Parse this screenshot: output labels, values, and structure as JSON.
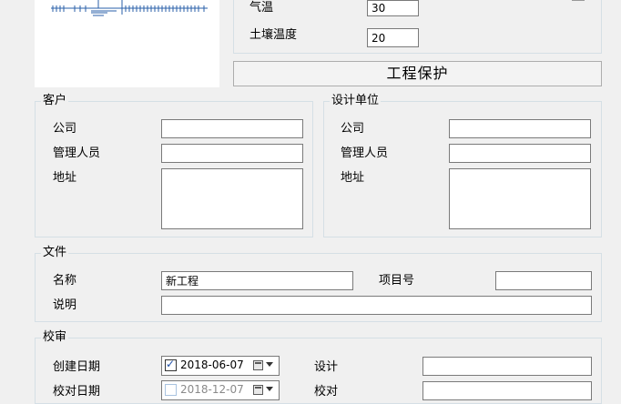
{
  "conditions": {
    "temperature_label": "气温",
    "temperature_value": "30",
    "soil_temp_label": "土壤温度",
    "soil_temp_value": "20"
  },
  "protect_button": "工程保护",
  "customer": {
    "title": "客户",
    "company_label": "公司",
    "company_value": "",
    "manager_label": "管理人员",
    "manager_value": "",
    "address_label": "地址",
    "address_value": ""
  },
  "design_unit": {
    "title": "设计单位",
    "company_label": "公司",
    "company_value": "",
    "manager_label": "管理人员",
    "manager_value": "",
    "address_label": "地址",
    "address_value": ""
  },
  "file": {
    "title": "文件",
    "name_label": "名称",
    "name_value": "新工程",
    "project_no_label": "项目号",
    "project_no_value": "",
    "description_label": "说明",
    "description_value": ""
  },
  "review": {
    "title": "校审",
    "created_label": "创建日期",
    "created_date": "2018-06-07",
    "created_checked": true,
    "design_label": "设计",
    "design_value": "",
    "check_label": "校对日期",
    "check_date": "2018-12-07",
    "check_checked": false,
    "checker_label": "校对",
    "checker_value": ""
  }
}
